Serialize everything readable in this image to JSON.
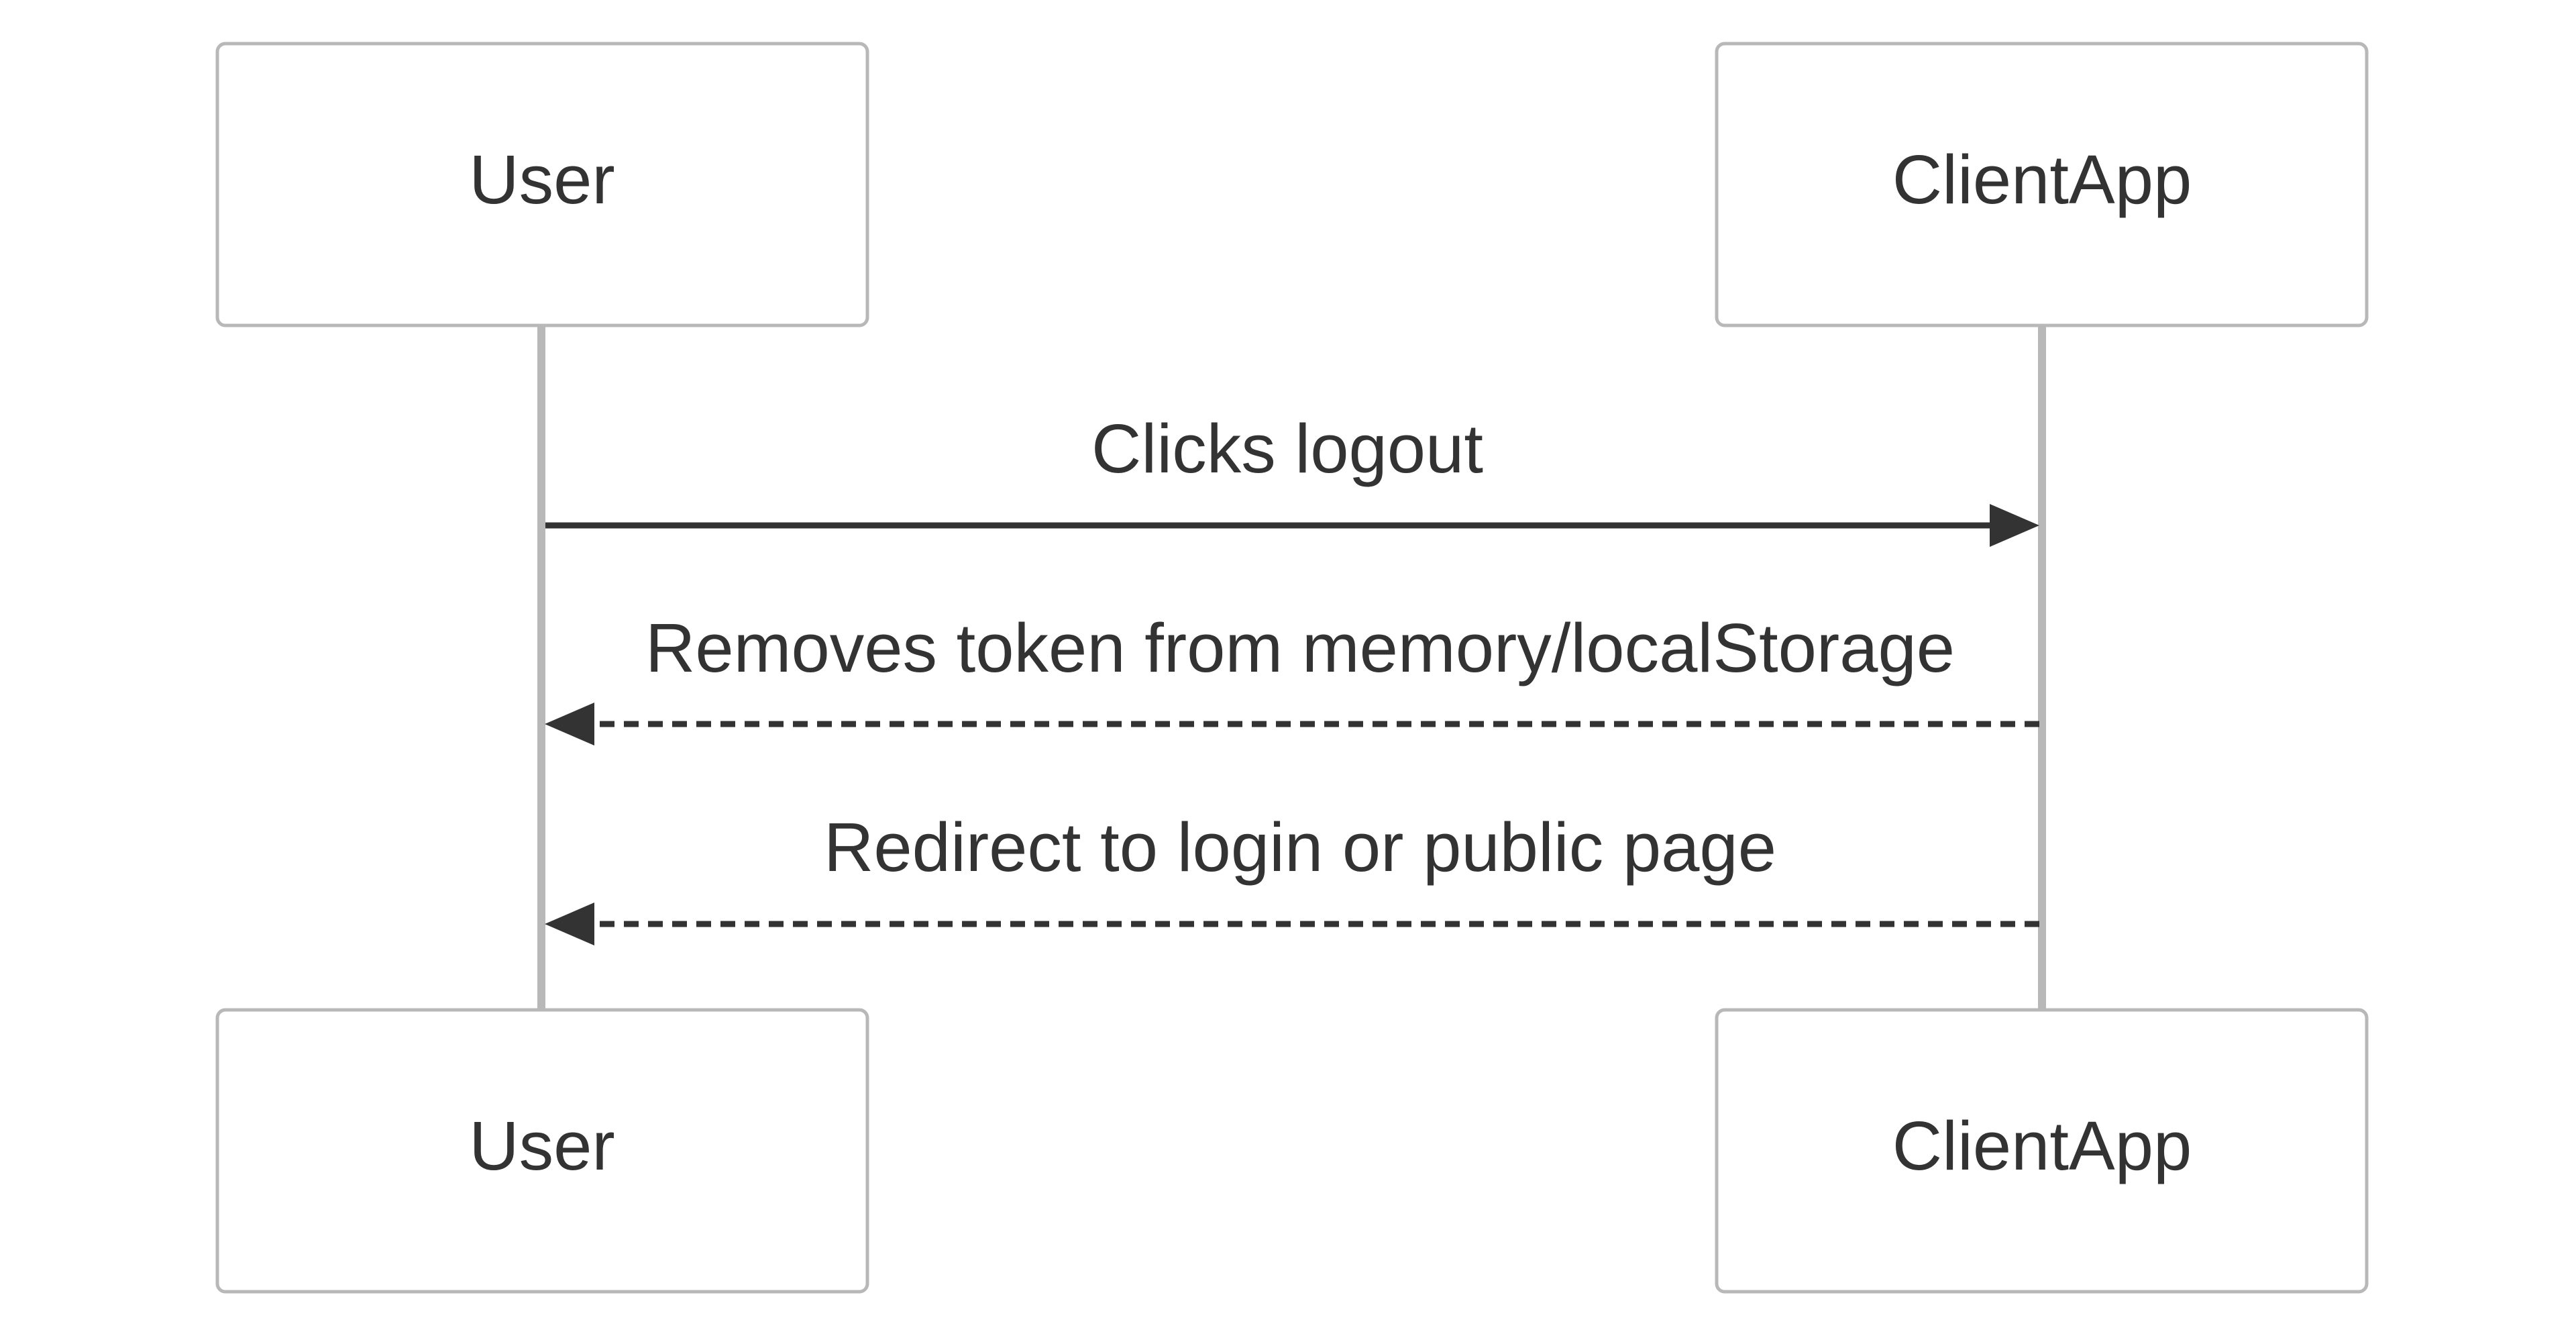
{
  "diagram": {
    "type": "sequence",
    "participants": [
      {
        "id": "user",
        "label": "User"
      },
      {
        "id": "client",
        "label": "ClientApp"
      }
    ],
    "messages": [
      {
        "from": "user",
        "to": "client",
        "label": "Clicks logout",
        "style": "solid"
      },
      {
        "from": "client",
        "to": "user",
        "label": "Removes token from memory/localStorage",
        "style": "dashed"
      },
      {
        "from": "client",
        "to": "user",
        "label": "Redirect to login or public page",
        "style": "dashed"
      }
    ]
  },
  "colors": {
    "box_border": "#b8b8b8",
    "lifeline": "#b8b8b8",
    "text": "#333333",
    "arrow": "#333333",
    "background": "#ffffff"
  }
}
